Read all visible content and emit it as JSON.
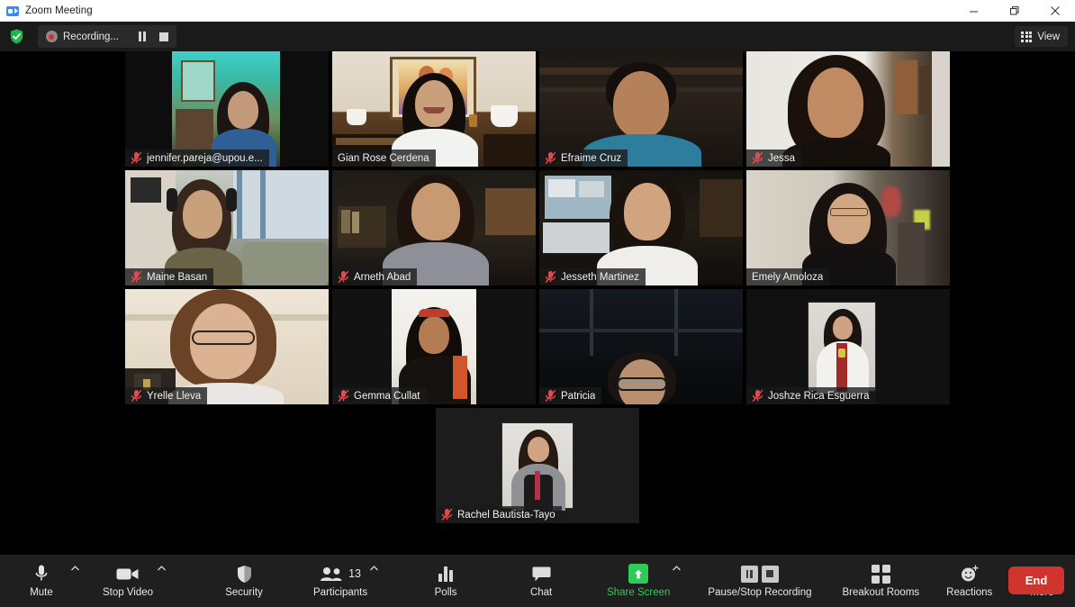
{
  "window": {
    "title": "Zoom Meeting",
    "app_icon": "zoom-camera-icon",
    "minimize_label": "—",
    "maximize_label": "❐",
    "close_label": "✕"
  },
  "topbar": {
    "shield_icon": "green-shield-check-icon",
    "recording_dot_icon": "recording-dot-icon",
    "recording_text": "Recording...",
    "pause_icon": "pause-icon",
    "stop_icon": "stop-icon",
    "view_label": "View",
    "view_icon": "grid-view-icon"
  },
  "gallery": {
    "rows": [
      [
        {
          "name": "jennifer.pareja@upou.e...",
          "muted": true,
          "active": false,
          "layout": "pillar",
          "scene": "s1"
        },
        {
          "name": "Gian Rose Cerdena",
          "muted": false,
          "active": true,
          "layout": "full",
          "scene": "s2"
        },
        {
          "name": "Efraime Cruz",
          "muted": true,
          "active": false,
          "layout": "full",
          "scene": "s3"
        },
        {
          "name": "Jessa",
          "muted": true,
          "active": false,
          "layout": "full",
          "scene": "s4"
        }
      ],
      [
        {
          "name": "Maine Basan",
          "muted": true,
          "active": false,
          "layout": "full",
          "scene": "s5"
        },
        {
          "name": "Arneth Abad",
          "muted": true,
          "active": false,
          "layout": "full",
          "scene": "s6"
        },
        {
          "name": "Jesseth Martinez",
          "muted": true,
          "active": false,
          "layout": "full",
          "scene": "s7"
        },
        {
          "name": "Emely Amoloza",
          "muted": false,
          "active": false,
          "layout": "full",
          "scene": "s8"
        }
      ],
      [
        {
          "name": "Yrelle Lleva",
          "muted": true,
          "active": false,
          "layout": "full",
          "scene": "s9"
        },
        {
          "name": "Gemma Cullat",
          "muted": true,
          "active": false,
          "layout": "portrait",
          "scene": "s10"
        },
        {
          "name": "Patricia",
          "muted": true,
          "active": false,
          "layout": "full",
          "scene": "s11"
        },
        {
          "name": "Joshze Rica Esguerra",
          "muted": true,
          "active": false,
          "layout": "photo",
          "scene": "s12"
        }
      ],
      [
        {
          "name": "Rachel Bautista-Tayo",
          "muted": true,
          "active": false,
          "layout": "photo",
          "scene": "s13"
        }
      ]
    ]
  },
  "toolbar": {
    "mute_label": "Mute",
    "mute_icon": "microphone-icon",
    "video_label": "Stop Video",
    "video_icon": "camera-icon",
    "security_label": "Security",
    "security_icon": "shield-icon",
    "participants_label": "Participants",
    "participants_icon": "people-icon",
    "participants_count": "13",
    "polls_label": "Polls",
    "polls_icon": "bar-chart-icon",
    "chat_label": "Chat",
    "chat_icon": "speech-bubble-icon",
    "share_label": "Share Screen",
    "share_icon": "share-screen-up-arrow-icon",
    "record_label": "Pause/Stop Recording",
    "record_pause_icon": "pause-icon",
    "record_stop_icon": "stop-icon",
    "breakout_label": "Breakout Rooms",
    "breakout_icon": "grid-squares-icon",
    "reactions_label": "Reactions",
    "reactions_icon": "smiley-plus-icon",
    "more_label": "More",
    "more_icon": "ellipsis-icon",
    "end_label": "End",
    "caret_icon": "chevron-up-icon"
  },
  "colors": {
    "accent_green": "#2ecc57",
    "end_red": "#d0342c",
    "active_border": "#d9e83a",
    "muted_red": "#e8484a",
    "toolbar_bg": "#1f1f1f",
    "stage_bg": "#000000"
  }
}
